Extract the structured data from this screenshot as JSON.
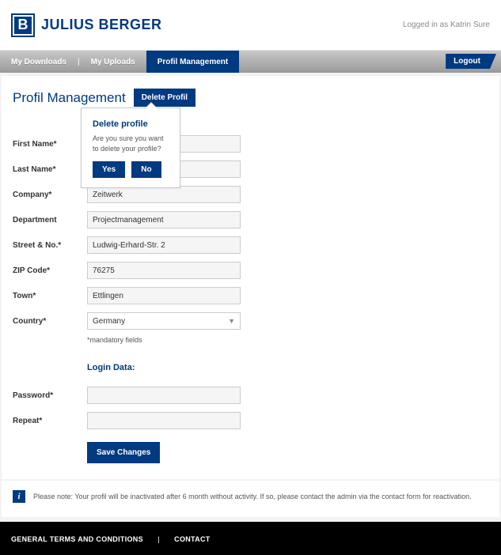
{
  "header": {
    "logo_letter": "B",
    "logo_text": "JULIUS BERGER",
    "logged_in": "Logged in as Katrin Sure"
  },
  "nav": {
    "downloads": "My Downloads",
    "uploads": "My Uploads",
    "profile": "Profil Management",
    "logout": "Logout"
  },
  "page": {
    "title": "Profil Management",
    "delete_label": "Delete Profil"
  },
  "popover": {
    "title": "Delete profile",
    "text": "Are you sure you want to delete your profile?",
    "yes": "Yes",
    "no": "No"
  },
  "form": {
    "labels": {
      "first_name": "First Name*",
      "last_name": "Last Name*",
      "company": "Company*",
      "department": "Department",
      "street": "Street & No.*",
      "zip": "ZIP Code*",
      "town": "Town*",
      "country": "Country*",
      "password": "Password*",
      "repeat": "Repeat*"
    },
    "values": {
      "first_name": "",
      "last_name": "",
      "company": "Zeitwerk",
      "department": "Projectmanagement",
      "street": "Ludwig-Erhard-Str. 2",
      "zip": "76275",
      "town": "Ettlingen",
      "country": "Germany",
      "password": "",
      "repeat": ""
    },
    "mandatory": "*mandatory fields",
    "login_data": "Login Data:",
    "save": "Save Changes"
  },
  "note": "Please note: Your profil will be inactivated after 6 month without activity. If so, please contact the admin via the contact form for reactivation.",
  "footer": {
    "terms": "GENERAL TERMS AND CONDITIONS",
    "contact": "CONTACT"
  }
}
